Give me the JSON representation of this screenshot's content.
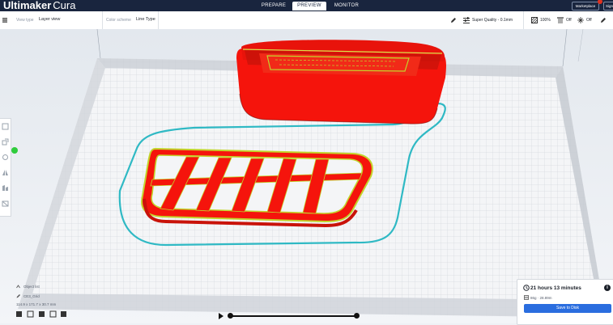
{
  "app": {
    "name_bold": "Ultimaker",
    "name_light": "Cura"
  },
  "tabs": [
    {
      "label": "PREPARE"
    },
    {
      "label": "PREVIEW",
      "active": true
    },
    {
      "label": "MONITOR"
    }
  ],
  "header_right": {
    "marketplace_label": "Marketplace",
    "signin_label": "Sign in"
  },
  "toolbar": {
    "view_type_label": "View type",
    "view_type_value": "Layer view",
    "color_scheme_label": "Color scheme",
    "color_scheme_value": "Line Type",
    "quality_value": "Super Quality - 0.1mm",
    "infill_value": "100%",
    "support_value": "Off",
    "adhesion_value": "Off"
  },
  "object_list": {
    "header": "Object list",
    "object_name": "CE3_Grid",
    "dimensions": "114.9 x 171.7 x 30.7 mm"
  },
  "print_summary": {
    "time": "21 hours 13 minutes",
    "material": "86g · 28.89m",
    "save_label": "Save to Disk"
  },
  "icons": {
    "view_type": "layer-view-icon",
    "edit": "pencil-icon",
    "quality": "quality-sliders-icon",
    "infill": "infill-icon",
    "support": "support-icon",
    "adhesion": "adhesion-icon",
    "clock": "clock-icon",
    "info": "info-icon",
    "material": "spool-icon"
  },
  "colors": {
    "topbar": "#19253e",
    "accent": "#2a6ddf",
    "model_wall": "#f5140c",
    "inner_wall": "#c3d42b",
    "skirt": "#2fb9c4",
    "active_tool": "#2fcc3c"
  }
}
